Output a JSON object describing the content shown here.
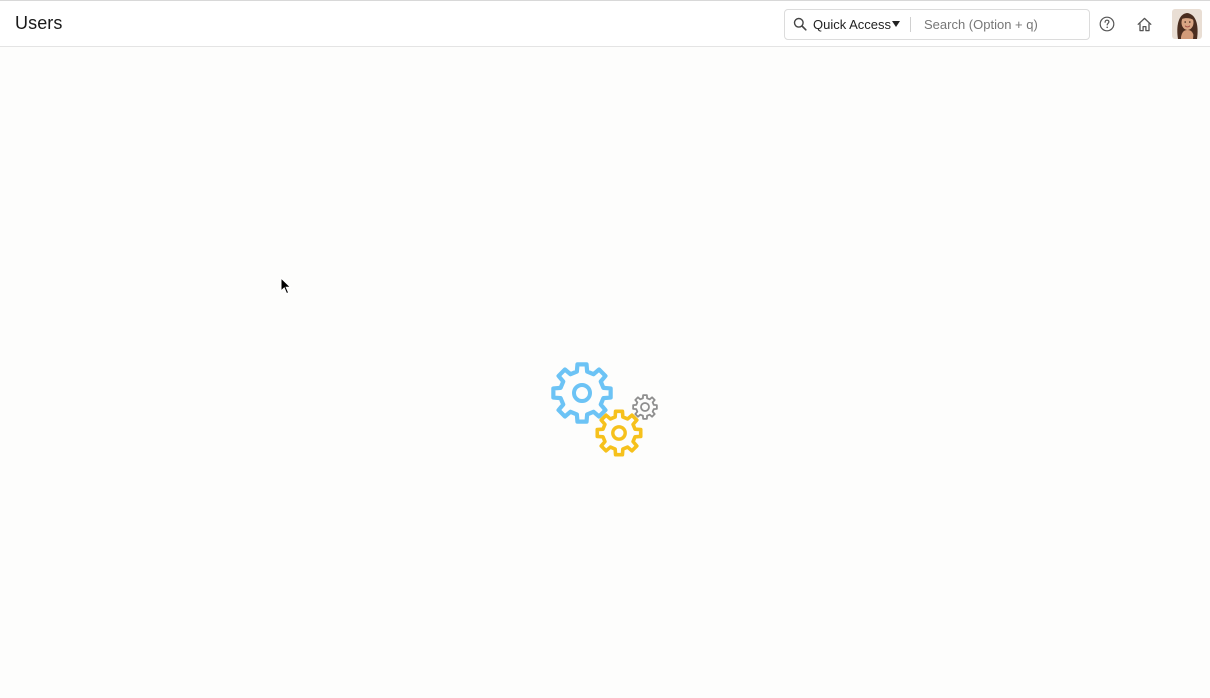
{
  "header": {
    "title": "Users"
  },
  "quick_access": {
    "label": "Quick Access",
    "search_icon": "search-icon",
    "caret_icon": "caret-down-icon"
  },
  "search": {
    "placeholder": "Search (Option + q)",
    "value": ""
  },
  "header_actions": {
    "help_icon": "help-circle-icon",
    "home_icon": "home-icon",
    "avatar": "user-avatar"
  },
  "main": {
    "loading_indicator": "gears-loading-icon",
    "colors": {
      "gear_large": "#6cc3f5",
      "gear_medium": "#f6c11c",
      "gear_small": "#8e8e8e"
    }
  }
}
